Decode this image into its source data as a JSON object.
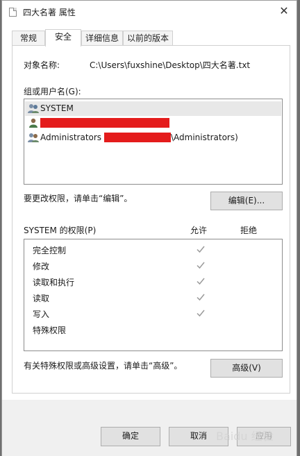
{
  "window": {
    "title": "四大名著 属性",
    "close_glyph": "✕"
  },
  "tabs": [
    {
      "label": "常规",
      "active": false
    },
    {
      "label": "安全",
      "active": true
    },
    {
      "label": "详细信息",
      "active": false
    },
    {
      "label": "以前的版本",
      "active": false
    }
  ],
  "object": {
    "label": "对象名称:",
    "value": "C:\\Users\\fuxshine\\Desktop\\四大名著.txt"
  },
  "groups": {
    "label": "组或用户名(G):",
    "items": [
      {
        "name": "SYSTEM",
        "icon": "group-users-icon",
        "selected": true
      },
      {
        "name": "",
        "icon": "user-icon",
        "redacted": true
      },
      {
        "name_prefix": "Administrators (",
        "name_suffix": "\\Administrators)",
        "icon": "group-users-icon",
        "redacted": true
      }
    ]
  },
  "change_prompt": "要更改权限，请单击“编辑”。",
  "edit_button": "编辑(E)...",
  "permissions": {
    "label": "SYSTEM 的权限(P)",
    "allow_header": "允许",
    "deny_header": "拒绝",
    "items": [
      {
        "name": "完全控制",
        "allow": true
      },
      {
        "name": "修改",
        "allow": true
      },
      {
        "name": "读取和执行",
        "allow": true
      },
      {
        "name": "读取",
        "allow": true
      },
      {
        "name": "写入",
        "allow": true
      },
      {
        "name": "特殊权限",
        "allow": false
      }
    ]
  },
  "advanced_prompt": "有关特殊权限或高级设置，请单击“高级”。",
  "advanced_button": "高级(V)",
  "footer": {
    "ok": "确定",
    "cancel": "取消",
    "apply": "应用"
  },
  "watermark": "Baidu 经验",
  "colors": {
    "redaction": "#e41c1c",
    "check": "#9a9a9a"
  }
}
